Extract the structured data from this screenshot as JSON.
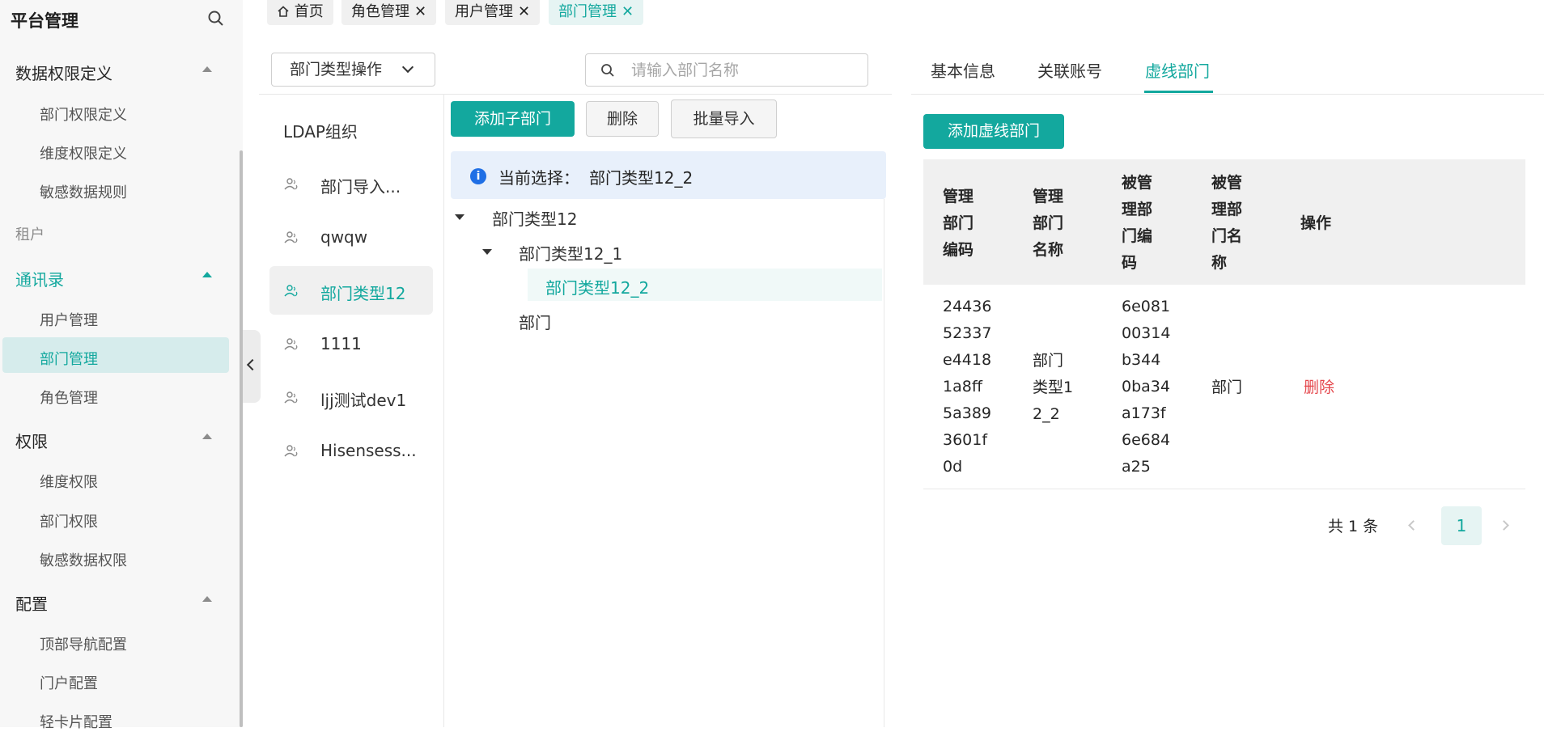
{
  "sidebar": {
    "title": "平台管理",
    "groups": [
      {
        "label": "数据权限定义",
        "items": [
          "部门权限定义",
          "维度权限定义",
          "敏感数据规则"
        ]
      },
      {
        "label": "租户"
      },
      {
        "label": "通讯录",
        "items": [
          "用户管理",
          "部门管理",
          "角色管理"
        ]
      },
      {
        "label": "权限",
        "items": [
          "维度权限",
          "部门权限",
          "敏感数据权限"
        ]
      },
      {
        "label": "配置",
        "items": [
          "顶部导航配置",
          "门户配置",
          "轻卡片配置"
        ]
      }
    ],
    "active_item": "部门管理"
  },
  "top_tabs": [
    {
      "label": "首页"
    },
    {
      "label": "角色管理"
    },
    {
      "label": "用户管理"
    },
    {
      "label": "部门管理"
    }
  ],
  "dept_panel": {
    "type_button": "部门类型操作",
    "search_placeholder": "请输入部门名称",
    "org_root": "LDAP组织",
    "orgs": [
      "部门导入...",
      "qwqw",
      "部门类型12",
      "1111",
      "ljj测试dev1",
      "Hisensess..."
    ],
    "active_org": "部门类型12",
    "buttons": {
      "add_child": "添加子部门",
      "delete": "删除",
      "batch_import": "批量导入"
    },
    "current_selection_label": "当前选择：",
    "current_selection_value": "部门类型12_2",
    "tree": [
      {
        "label": "部门类型12"
      },
      {
        "label": "部门类型12_1"
      },
      {
        "label": "部门类型12_2"
      },
      {
        "label": "部门"
      }
    ]
  },
  "detail_panel": {
    "tabs": [
      "基本信息",
      "关联账号",
      "虚线部门"
    ],
    "active_tab": "虚线部门",
    "add_button": "添加虚线部门",
    "columns": [
      "管理\n部门\n编码",
      "管理\n部门\n名称",
      "被管\n理部\n门编\n码",
      "被管\n理部\n门名\n称",
      "操作"
    ],
    "rows": [
      {
        "mgr_code": "24436\n52337\ne4418\n1a8ff\n5a389\n3601f\n0d",
        "mgr_name": "部门\n类型1\n2_2",
        "sub_code": "6e081\n00314\nb344\n0ba34\na173f\n6e684\na25",
        "sub_name": "部门",
        "action": "删除"
      }
    ],
    "pagination": {
      "total_text": "共 1 条",
      "current_page": "1"
    }
  },
  "colors": {
    "accent": "#13a89e",
    "danger": "#e5484d",
    "info": "#1f6fe5"
  }
}
